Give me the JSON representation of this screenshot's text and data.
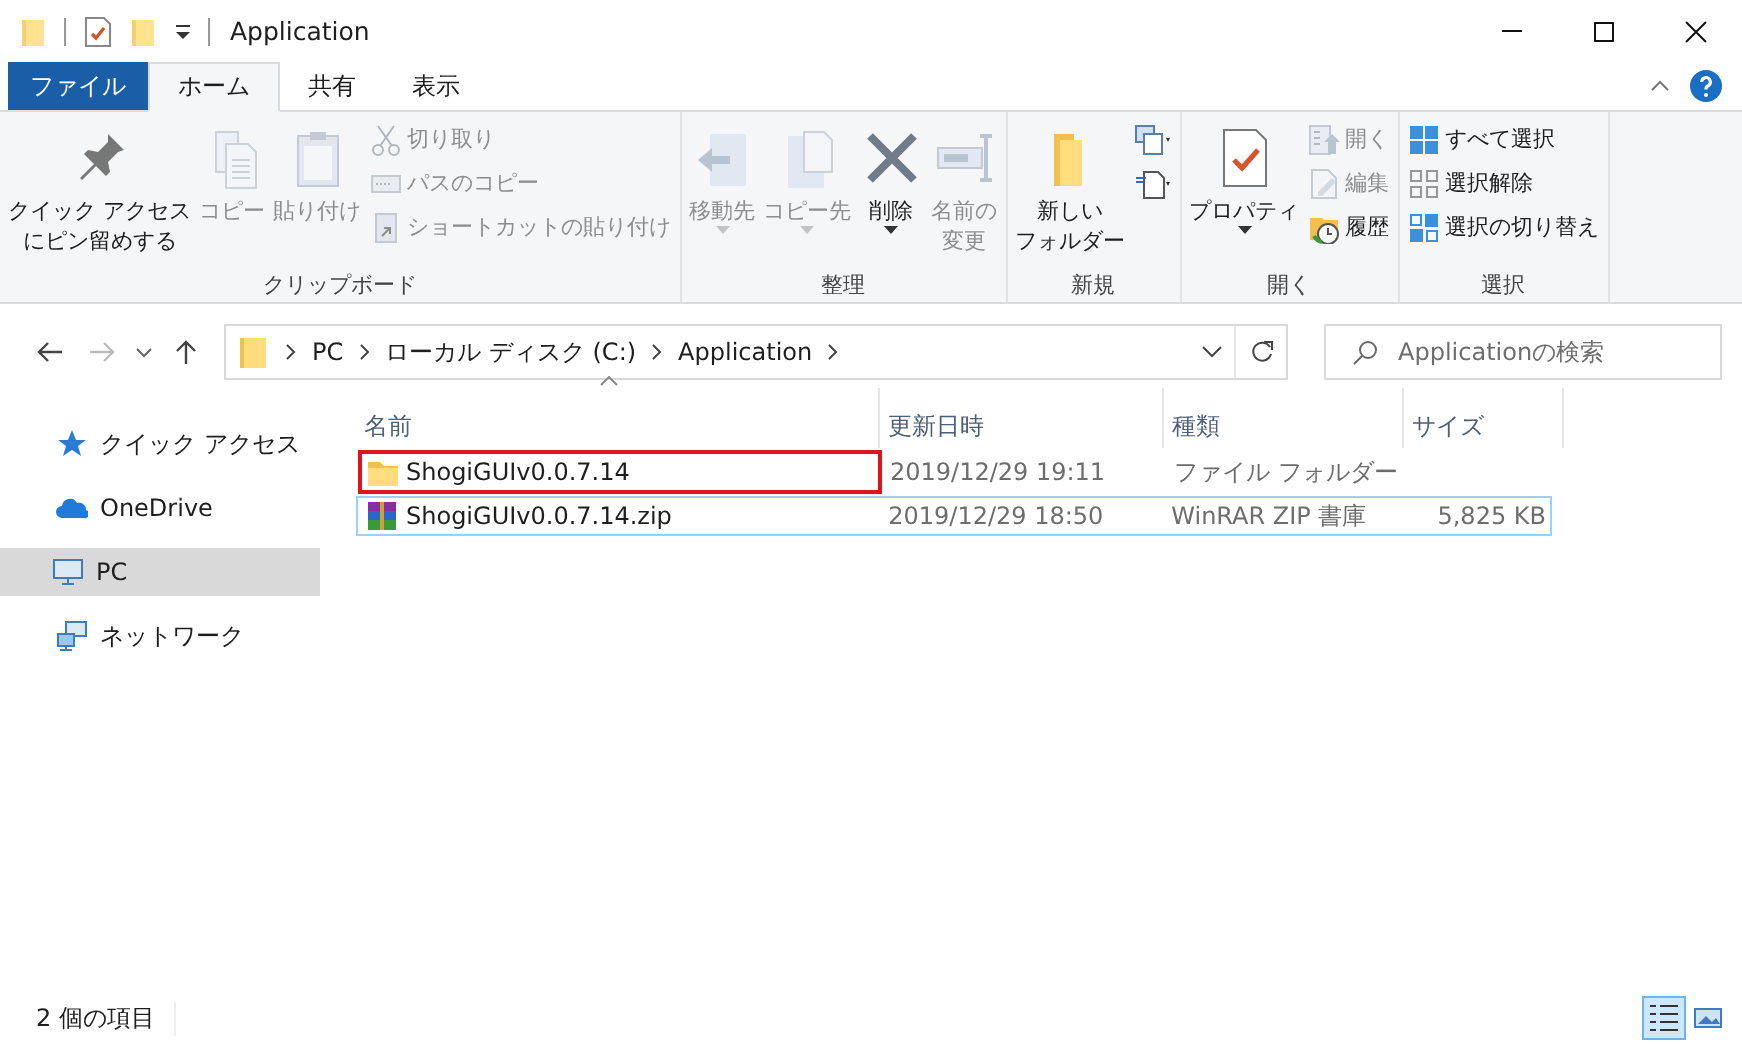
{
  "window": {
    "title": "Application"
  },
  "ribbon_tabs": [
    {
      "label": "ファイル",
      "kind": "file",
      "selected": false
    },
    {
      "label": "ホーム",
      "kind": "tab",
      "selected": true
    },
    {
      "label": "共有",
      "kind": "tab",
      "selected": false
    },
    {
      "label": "表示",
      "kind": "tab",
      "selected": false
    }
  ],
  "ribbon_groups": [
    {
      "label": "クリップボード",
      "items": [
        {
          "lines": [
            "クイック アクセス",
            "にピン留めする"
          ],
          "kind": "large",
          "disabled": false
        },
        {
          "lines": [
            "コピー"
          ],
          "kind": "large",
          "disabled": true
        },
        {
          "lines": [
            "貼り付け"
          ],
          "kind": "large",
          "disabled": true
        },
        {
          "label": "切り取り",
          "kind": "small",
          "disabled": true
        },
        {
          "label": "パスのコピー",
          "kind": "small",
          "disabled": true
        },
        {
          "label": "ショートカットの貼り付け",
          "kind": "small",
          "disabled": true
        }
      ]
    },
    {
      "label": "整理",
      "items": [
        {
          "lines": [
            "移動先"
          ],
          "kind": "large",
          "disabled": true
        },
        {
          "lines": [
            "コピー先"
          ],
          "kind": "large",
          "disabled": true
        },
        {
          "lines": [
            "削除"
          ],
          "kind": "large",
          "disabled": false
        },
        {
          "lines": [
            "名前の",
            "変更"
          ],
          "kind": "large",
          "disabled": true
        }
      ]
    },
    {
      "label": "新規",
      "items": [
        {
          "lines": [
            "新しい",
            "フォルダー"
          ],
          "kind": "large",
          "disabled": false
        },
        {
          "kind": "iconsmall",
          "disabled": false
        },
        {
          "kind": "iconsmall",
          "disabled": false
        }
      ]
    },
    {
      "label": "開く",
      "items": [
        {
          "lines": [
            "プロパティ"
          ],
          "kind": "large",
          "disabled": false
        },
        {
          "label": "開く",
          "kind": "small",
          "disabled": true
        },
        {
          "label": "編集",
          "kind": "small",
          "disabled": true
        },
        {
          "label": "履歴",
          "kind": "small",
          "disabled": false
        }
      ]
    },
    {
      "label": "選択",
      "items": [
        {
          "label": "すべて選択",
          "kind": "small",
          "disabled": false
        },
        {
          "label": "選択解除",
          "kind": "small",
          "disabled": false
        },
        {
          "label": "選択の切り替え",
          "kind": "small",
          "disabled": false
        }
      ]
    }
  ],
  "address_bar": {
    "crumbs": [
      "PC",
      "ローカル ディスク (C:)",
      "Application"
    ]
  },
  "search": {
    "placeholder": "Applicationの検索"
  },
  "nav_pane": {
    "items": [
      {
        "label": "クイック アクセス",
        "selected": false
      },
      {
        "label": "OneDrive",
        "selected": false
      },
      {
        "label": "PC",
        "selected": true
      },
      {
        "label": "ネットワーク",
        "selected": false
      }
    ]
  },
  "file_list": {
    "columns": [
      "名前",
      "更新日時",
      "種類",
      "サイズ"
    ],
    "rows": [
      {
        "kind": "folder",
        "name": "ShogiGUIv0.0.7.14",
        "modified": "2019/12/29 19:11",
        "type": "ファイル フォルダー",
        "highlighted": true,
        "focused": false
      },
      {
        "kind": "archive",
        "name": "ShogiGUIv0.0.7.14.zip",
        "modified": "2019/12/29 18:50",
        "type": "WinRAR ZIP 書庫",
        "size": "5,825 KB",
        "highlighted": false,
        "focused": true
      }
    ]
  },
  "status_bar": {
    "text": "2 個の項目",
    "views": [
      {
        "kind": "details",
        "selected": true
      },
      {
        "kind": "large",
        "selected": false
      }
    ]
  }
}
